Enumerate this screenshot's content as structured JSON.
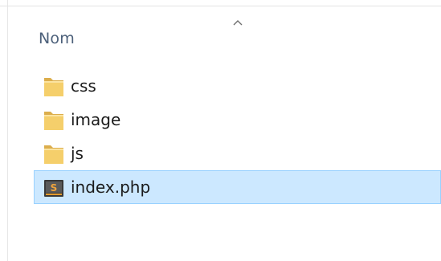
{
  "column": {
    "name": "Nom",
    "sort_indicator": "chevron-up-icon"
  },
  "files": [
    {
      "name": "css",
      "type": "folder",
      "icon": "folder-icon"
    },
    {
      "name": "image",
      "type": "folder",
      "icon": "folder-icon"
    },
    {
      "name": "js",
      "type": "folder",
      "icon": "folder-icon"
    },
    {
      "name": "index.php",
      "type": "file",
      "icon": "php-file-icon"
    }
  ],
  "selected_file": "index.php",
  "colors": {
    "selection_fill": "#cce8ff",
    "selection_border": "#99d1ff",
    "header_text": "#4c607a",
    "folder": "#f2c45c"
  }
}
